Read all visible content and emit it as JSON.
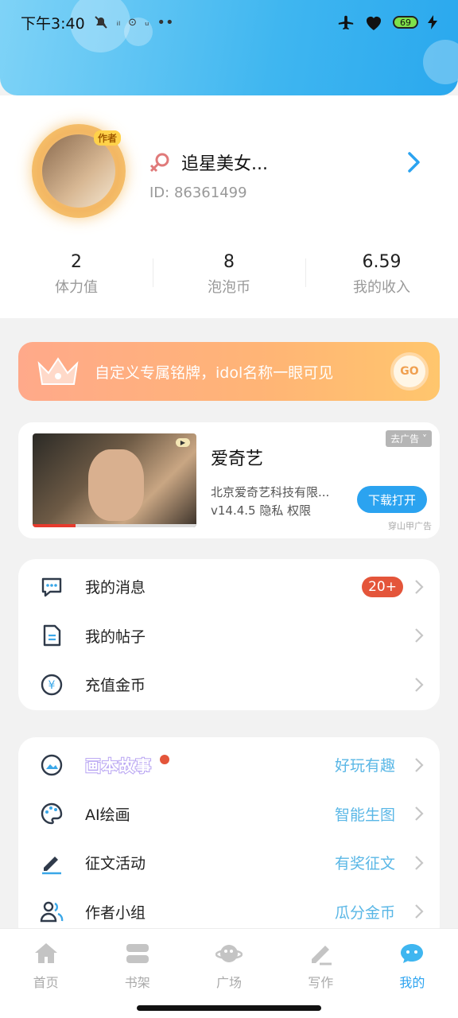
{
  "status_bar": {
    "time": "下午3:40",
    "left_icons": [
      "mute-icon",
      "signal-text",
      "notification-icons"
    ],
    "right_icons": [
      "airplane-icon",
      "heart-shield-icon",
      "battery-icon",
      "charging-icon"
    ],
    "battery": "69"
  },
  "profile": {
    "avatar_badge": "作者",
    "username": "追星美女...",
    "id_text": "ID: 86361499",
    "stats": [
      {
        "value": "2",
        "label": "体力值"
      },
      {
        "value": "8",
        "label": "泡泡币"
      },
      {
        "value": "6.59",
        "label": "我的收入"
      }
    ]
  },
  "promo": {
    "text": "自定义专属铭牌，idol名称一眼可见",
    "button": "GO"
  },
  "ad": {
    "title": "爱奇艺",
    "company": "北京爱奇艺科技有限...",
    "meta": "v14.4.5  隐私  权限",
    "remove_label": "去广告 ˅",
    "download_label": "下载打开",
    "source": "穿山甲广告"
  },
  "menu_group_1": [
    {
      "label": "我的消息",
      "badge": "20+"
    },
    {
      "label": "我的帖子"
    },
    {
      "label": "充值金币"
    }
  ],
  "menu_group_2": [
    {
      "label": "画本故事",
      "sub": "好玩有趣"
    },
    {
      "label": "AI绘画",
      "sub": "智能生图"
    },
    {
      "label": "征文活动",
      "sub": "有奖征文"
    },
    {
      "label": "作者小组",
      "sub": "瓜分金币"
    }
  ],
  "tabs": [
    {
      "label": "首页"
    },
    {
      "label": "书架"
    },
    {
      "label": "广场"
    },
    {
      "label": "写作"
    },
    {
      "label": "我的",
      "active": true
    }
  ],
  "colors": {
    "accent": "#2ba3f0",
    "badge": "#e4553a",
    "sub_text": "#5ab7e6"
  }
}
